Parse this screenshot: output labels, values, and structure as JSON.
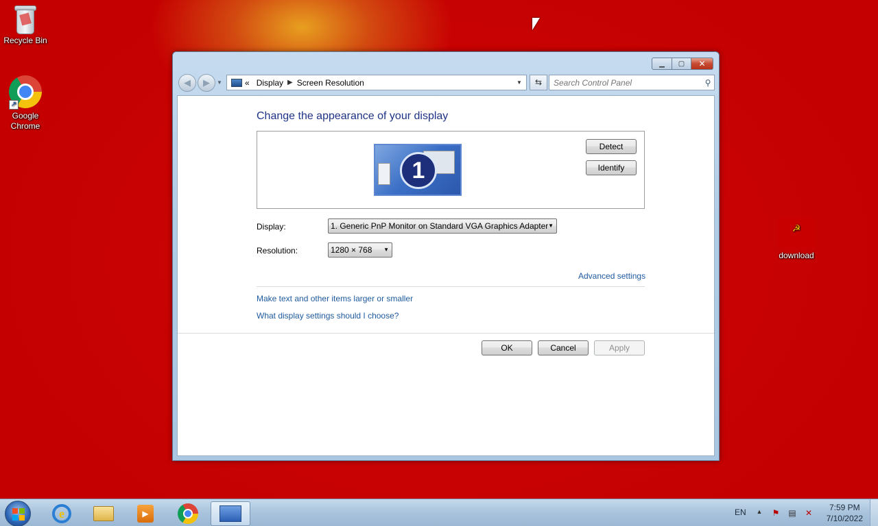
{
  "desktop": {
    "icons": [
      {
        "label": "Recycle Bin"
      },
      {
        "label": "Google Chrome"
      },
      {
        "label": "download"
      }
    ]
  },
  "window": {
    "address": {
      "back_icon": "back-arrow-icon",
      "crumbs": [
        "Display",
        "Screen Resolution"
      ],
      "overflow": "«"
    },
    "search": {
      "placeholder": "Search Control Panel"
    },
    "heading": "Change the appearance of your display",
    "monitor_number": "1",
    "buttons": {
      "detect": "Detect",
      "identify": "Identify",
      "ok": "OK",
      "cancel": "Cancel",
      "apply": "Apply"
    },
    "display": {
      "label": "Display:",
      "value": "1. Generic PnP Monitor on Standard VGA Graphics Adapter"
    },
    "resolution": {
      "label": "Resolution:",
      "value": "1280 × 768"
    },
    "links": {
      "advanced": "Advanced settings",
      "text_size": "Make text and other items larger or smaller",
      "help": "What display settings should I choose?"
    }
  },
  "taskbar": {
    "apps": [
      {
        "name": "Internet Explorer",
        "icon": "ie-icon"
      },
      {
        "name": "Windows Explorer",
        "icon": "folder-icon"
      },
      {
        "name": "Windows Media Player",
        "icon": "media-player-icon"
      },
      {
        "name": "Google Chrome",
        "icon": "chrome-icon"
      },
      {
        "name": "Control Panel",
        "icon": "control-panel-icon",
        "active": true
      }
    ],
    "language": "EN",
    "time": "7:59 PM",
    "date": "7/10/2022"
  }
}
